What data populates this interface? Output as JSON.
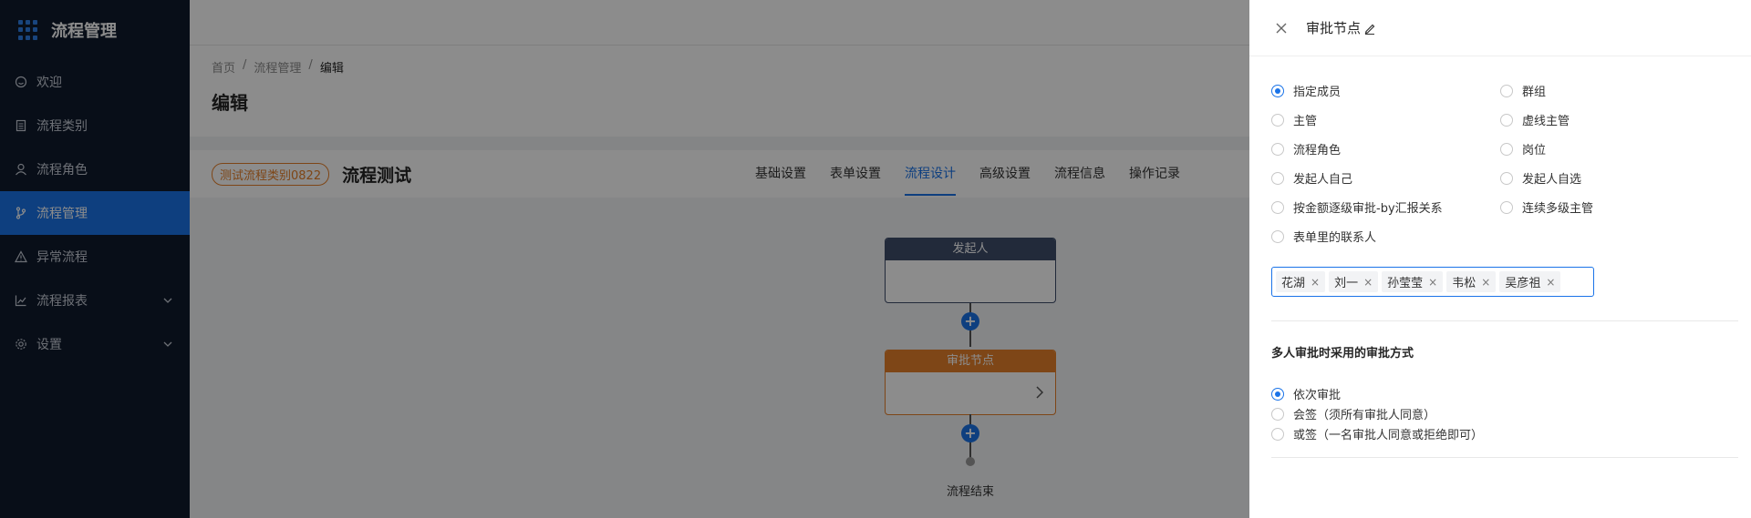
{
  "sidebar": {
    "brand": "流程管理",
    "items": [
      {
        "label": "欢迎",
        "icon": "smile-icon"
      },
      {
        "label": "流程类别",
        "icon": "doc-icon"
      },
      {
        "label": "流程角色",
        "icon": "user-icon"
      },
      {
        "label": "流程管理",
        "icon": "branch-icon",
        "active": true
      },
      {
        "label": "异常流程",
        "icon": "warning-icon"
      },
      {
        "label": "流程报表",
        "icon": "chart-icon",
        "chevron": true
      },
      {
        "label": "设置",
        "icon": "gear-icon",
        "chevron": true
      }
    ]
  },
  "header": {
    "breadcrumb": [
      "首页",
      "流程管理",
      "编辑"
    ],
    "separator": "/",
    "page_title": "编辑"
  },
  "workflow": {
    "category_tag": "测试流程类别0822",
    "name": "流程测试",
    "tabs": [
      "基础设置",
      "表单设置",
      "流程设计",
      "高级设置",
      "流程信息",
      "操作记录"
    ],
    "active_tab": "流程设计"
  },
  "canvas": {
    "start_node": "发起人",
    "approve_node": "审批节点",
    "end_label": "流程结束",
    "add_symbol": "+"
  },
  "drawer": {
    "title": "审批节点",
    "approver_options_left": [
      "指定成员",
      "主管",
      "流程角色",
      "发起人自己",
      "按金额逐级审批-by汇报关系",
      "表单里的联系人"
    ],
    "approver_options_right": [
      "群组",
      "虚线主管",
      "岗位",
      "发起人自选",
      "连续多级主管"
    ],
    "selected_approver": "指定成员",
    "members": [
      "花湖",
      "刘一",
      "孙莹莹",
      "韦松",
      "吴彦祖"
    ],
    "chip_remove": "×",
    "multi_title": "多人审批时采用的审批方式",
    "multi_options": [
      "依次审批",
      "会签（须所有审批人同意）",
      "或签（一名审批人同意或拒绝即可）"
    ],
    "selected_multi": "依次审批"
  },
  "colors": {
    "accent": "#1a73e8",
    "sidebar_bg": "#0f1a2c",
    "approve_node": "#e6802a",
    "start_node": "#3e4d6b"
  }
}
